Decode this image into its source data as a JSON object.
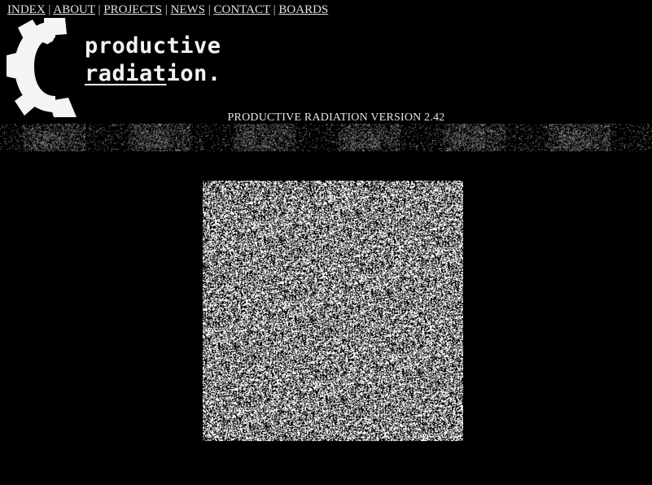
{
  "nav": {
    "items": [
      {
        "label": "INDEX"
      },
      {
        "label": "ABOUT"
      },
      {
        "label": "PROJECTS"
      },
      {
        "label": "NEWS"
      },
      {
        "label": "CONTACT"
      },
      {
        "label": "BOARDS"
      }
    ],
    "separator": "|"
  },
  "logo": {
    "line1": "productive",
    "line2_underlined": "radiat",
    "line2_rest": "ion.",
    "icon": "gear-icon"
  },
  "version_text": "PRODUCTIVE RADIATION VERSION 2.42",
  "colors": {
    "background": "#000000",
    "text": "#e0e0e0",
    "noise_light": "#ffffff",
    "noise_dark": "#000000"
  }
}
